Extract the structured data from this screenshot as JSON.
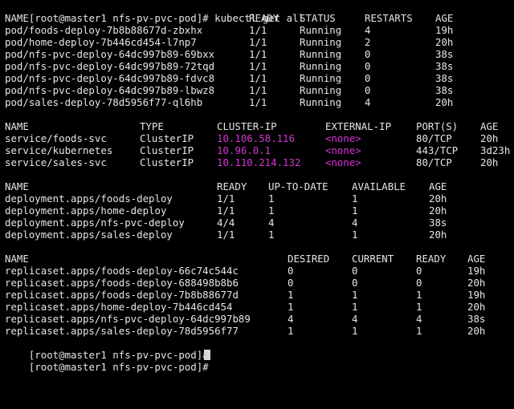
{
  "terminal": {
    "prompt": "[root@master1 nfs-pv-pvc-pod]# ",
    "command": "kubectl get all",
    "pods": {
      "headers": [
        "NAME",
        "READY",
        "STATUS",
        "RESTARTS",
        "AGE"
      ],
      "rows": [
        [
          "pod/foods-deploy-7b8b88677d-zbxhx",
          "1/1",
          "Running",
          "4",
          "19h"
        ],
        [
          "pod/home-deploy-7b446cd454-l7np7",
          "1/1",
          "Running",
          "2",
          "20h"
        ],
        [
          "pod/nfs-pvc-deploy-64dc997b89-69bxx",
          "1/1",
          "Running",
          "0",
          "38s"
        ],
        [
          "pod/nfs-pvc-deploy-64dc997b89-72tqd",
          "1/1",
          "Running",
          "0",
          "38s"
        ],
        [
          "pod/nfs-pvc-deploy-64dc997b89-fdvc8",
          "1/1",
          "Running",
          "0",
          "38s"
        ],
        [
          "pod/nfs-pvc-deploy-64dc997b89-lbwz8",
          "1/1",
          "Running",
          "0",
          "38s"
        ],
        [
          "pod/sales-deploy-78d5956f77-ql6hb",
          "1/1",
          "Running",
          "4",
          "20h"
        ]
      ]
    },
    "services": {
      "headers": [
        "NAME",
        "TYPE",
        "CLUSTER-IP",
        "EXTERNAL-IP",
        "PORT(S)",
        "AGE"
      ],
      "rows": [
        [
          "service/foods-svc",
          "ClusterIP",
          "10.106.58.116",
          "<none>",
          "80/TCP",
          "20h"
        ],
        [
          "service/kubernetes",
          "ClusterIP",
          "10.96.0.1",
          "<none>",
          "443/TCP",
          "3d23h"
        ],
        [
          "service/sales-svc",
          "ClusterIP",
          "10.110.214.132",
          "<none>",
          "80/TCP",
          "20h"
        ]
      ]
    },
    "deployments": {
      "headers": [
        "NAME",
        "READY",
        "UP-TO-DATE",
        "AVAILABLE",
        "AGE"
      ],
      "rows": [
        [
          "deployment.apps/foods-deploy",
          "1/1",
          "1",
          "1",
          "20h"
        ],
        [
          "deployment.apps/home-deploy",
          "1/1",
          "1",
          "1",
          "20h"
        ],
        [
          "deployment.apps/nfs-pvc-deploy",
          "4/4",
          "4",
          "4",
          "38s"
        ],
        [
          "deployment.apps/sales-deploy",
          "1/1",
          "1",
          "1",
          "20h"
        ]
      ]
    },
    "replicasets": {
      "headers": [
        "NAME",
        "DESIRED",
        "CURRENT",
        "READY",
        "AGE"
      ],
      "rows": [
        [
          "replicaset.apps/foods-deploy-66c74c544c",
          "0",
          "0",
          "0",
          "19h"
        ],
        [
          "replicaset.apps/foods-deploy-688498b8b6",
          "0",
          "0",
          "0",
          "20h"
        ],
        [
          "replicaset.apps/foods-deploy-7b8b88677d",
          "1",
          "1",
          "1",
          "19h"
        ],
        [
          "replicaset.apps/home-deploy-7b446cd454",
          "1",
          "1",
          "1",
          "20h"
        ],
        [
          "replicaset.apps/nfs-pvc-deploy-64dc997b89",
          "4",
          "4",
          "4",
          "38s"
        ],
        [
          "replicaset.apps/sales-deploy-78d5956f77",
          "1",
          "1",
          "1",
          "20h"
        ]
      ]
    },
    "colors": {
      "background": "#000000",
      "text": "#e6e6e6",
      "highlight": "#d238d2",
      "cursor": "#d8d8d8"
    }
  }
}
